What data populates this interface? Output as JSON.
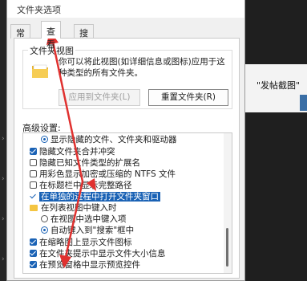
{
  "background": {
    "right_text": "\"发帖截图\""
  },
  "dialog": {
    "title": "文件夹选项",
    "tabs": [
      {
        "label": "常规",
        "active": false
      },
      {
        "label": "查看",
        "active": true
      },
      {
        "label": "搜索",
        "active": false
      }
    ],
    "folder_view": {
      "group_title": "文件夹视图",
      "description": "你可以将此视图(如详细信息或图标)应用于这种类型的所有文件夹。",
      "apply_button": "应用到文件夹(L)",
      "reset_button": "重置文件夹(R)"
    },
    "advanced": {
      "label": "高级设置:",
      "items": [
        {
          "type": "radio",
          "checked": true,
          "label": "显示隐藏的文件、文件夹和驱动器",
          "indent": 1
        },
        {
          "type": "checkbox",
          "checked": true,
          "label": "隐藏文件夹合并冲突",
          "indent": 0
        },
        {
          "type": "checkbox",
          "checked": false,
          "label": "隐藏已知文件类型的扩展名",
          "indent": 0
        },
        {
          "type": "checkbox",
          "checked": false,
          "label": "用彩色显示加密或压缩的 NTFS 文件",
          "indent": 0
        },
        {
          "type": "checkbox",
          "checked": false,
          "label": "在标题栏中显示完整路径",
          "indent": 0
        },
        {
          "type": "checkbox",
          "checked": true,
          "label": "在单独的进程中打开文件夹窗口",
          "indent": 0,
          "selected": true
        },
        {
          "type": "folder",
          "label": "在列表视图中键入时",
          "indent": 0
        },
        {
          "type": "radio",
          "checked": false,
          "label": "在视图中选中键入项",
          "indent": 1
        },
        {
          "type": "radio",
          "checked": true,
          "label": "自动键入到\"搜索\"框中",
          "indent": 1
        },
        {
          "type": "checkbox",
          "checked": true,
          "label": "在缩略图上显示文件图标",
          "indent": 0
        },
        {
          "type": "checkbox",
          "checked": true,
          "label": "在文件夹提示中显示文件大小信息",
          "indent": 0
        },
        {
          "type": "checkbox",
          "checked": true,
          "label": "在预览窗格中显示预览控件",
          "indent": 0
        }
      ]
    }
  },
  "colors": {
    "accent": "#1a62b5",
    "annotation": "#e0312f"
  }
}
